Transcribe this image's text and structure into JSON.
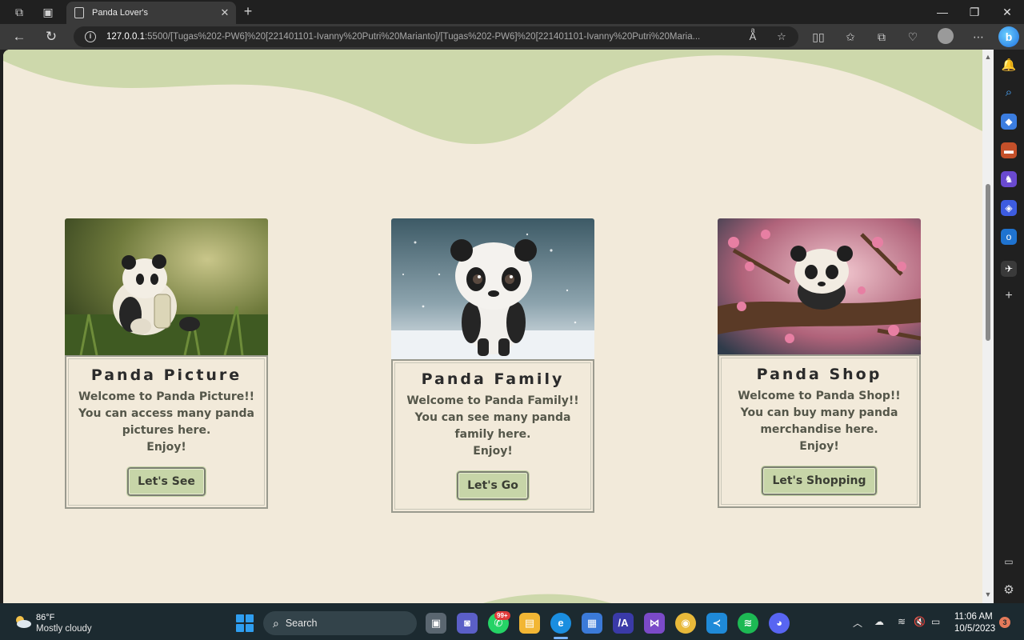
{
  "browser": {
    "tab_title": "Panda Lover's",
    "url_host": "127.0.0.1",
    "url_path": ":5500/[Tugas%202-PW6]%20[221401101-Ivanny%20Putri%20Marianto]/[Tugas%202-PW6]%20[221401101-Ivanny%20Putri%20Maria..."
  },
  "page": {
    "colors": {
      "background": "#f2eada",
      "wave": "#cdd8ab",
      "button": "#c7d5a8"
    },
    "cards": [
      {
        "title": "Panda Picture",
        "lines": [
          "Welcome to Panda Picture!!",
          "You can access many panda",
          "pictures here.",
          "Enjoy!"
        ],
        "button": "Let's See",
        "image": "panda-in-grass-image"
      },
      {
        "title": "Panda Family",
        "lines": [
          "Welcome to Panda Family!!",
          "You can see many panda",
          "family here.",
          "Enjoy!"
        ],
        "button": "Let's Go",
        "image": "panda-in-snow-image"
      },
      {
        "title": "Panda Shop",
        "lines": [
          "Welcome to Panda Shop!!",
          "You can buy many panda",
          "merchandise here.",
          "Enjoy!"
        ],
        "button": "Let's Shopping",
        "image": "panda-on-cherry-branch-image"
      }
    ]
  },
  "taskbar": {
    "weather_temp": "86°F",
    "weather_desc": "Mostly cloudy",
    "search_label": "Search",
    "whatsapp_badge": "99+",
    "time": "11:06 AM",
    "date": "10/5/2023",
    "notification_count": "3"
  }
}
